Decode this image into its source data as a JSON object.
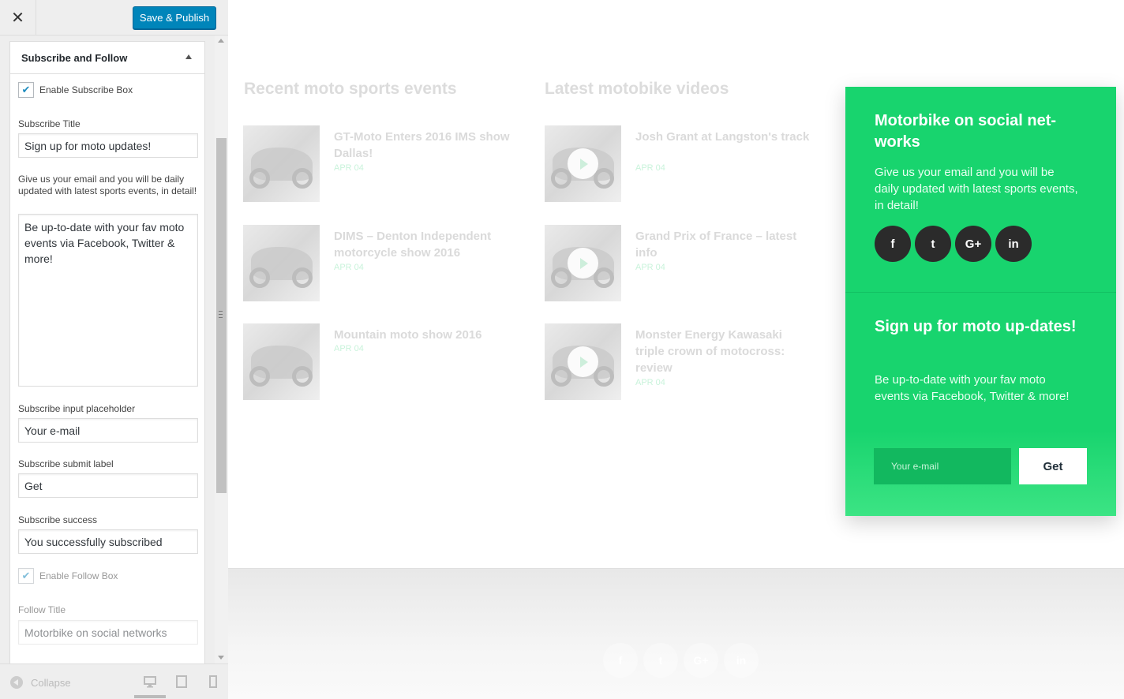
{
  "sidebar": {
    "close_icon": "close-icon",
    "publish_label": "Save & Publish",
    "section_title": "Subscribe and Follow",
    "enable_subscribe_label": "Enable Subscribe Box",
    "subscribe_title_label": "Subscribe Title",
    "subscribe_title_value": "Sign up for moto updates!",
    "subscribe_text_label": "Give us your email and you will be daily updated with latest sports events, in detail!",
    "subscribe_text_value": "Be up-to-date with your fav moto events via Facebook, Twitter & more!",
    "placeholder_label": "Subscribe input placeholder",
    "placeholder_value": "Your e-mail",
    "submit_label_label": "Subscribe submit label",
    "submit_label_value": "Get",
    "success_label": "Subscribe success",
    "success_value": "You successfully subscribed",
    "enable_follow_label": "Enable Follow Box",
    "follow_title_label": "Follow Title",
    "follow_title_value": "Motorbike on social networks",
    "collapse_label": "Collapse",
    "devices": [
      "desktop-icon",
      "tablet-icon",
      "mobile-icon"
    ]
  },
  "preview": {
    "recent_title": "Recent moto sports events",
    "videos_title": "Latest motobike videos",
    "recent_posts": [
      {
        "title": "GT-Moto Enters 2016 IMS show Dallas!",
        "date": "APR 04"
      },
      {
        "title": "DIMS – Denton Independent motorcycle show 2016",
        "date": "APR 04"
      },
      {
        "title": "Mountain moto show 2016",
        "date": "APR 04"
      }
    ],
    "video_posts": [
      {
        "title": "Josh Grant at Langston's track",
        "date": "APR 04"
      },
      {
        "title": "Grand Prix of France – latest info",
        "date": "APR 04"
      },
      {
        "title": "Monster Energy Kawasaki triple crown of motocross: review",
        "date": "APR 04"
      }
    ],
    "follow_box": {
      "title": "Motorbike on social net-works",
      "text": "Give us your email and you will be daily updated with latest sports events, in detail!",
      "social": [
        "f",
        "t",
        "G+",
        "in"
      ]
    },
    "subscribe_box": {
      "title": "Sign up for moto up-dates!",
      "text": "Be up-to-date with your fav moto events via Facebook, Twitter & more!",
      "placeholder": "Your e-mail",
      "button": "Get"
    },
    "footer_social": [
      "f",
      "t",
      "G+",
      "in"
    ],
    "accent_color": "#18d46e"
  }
}
